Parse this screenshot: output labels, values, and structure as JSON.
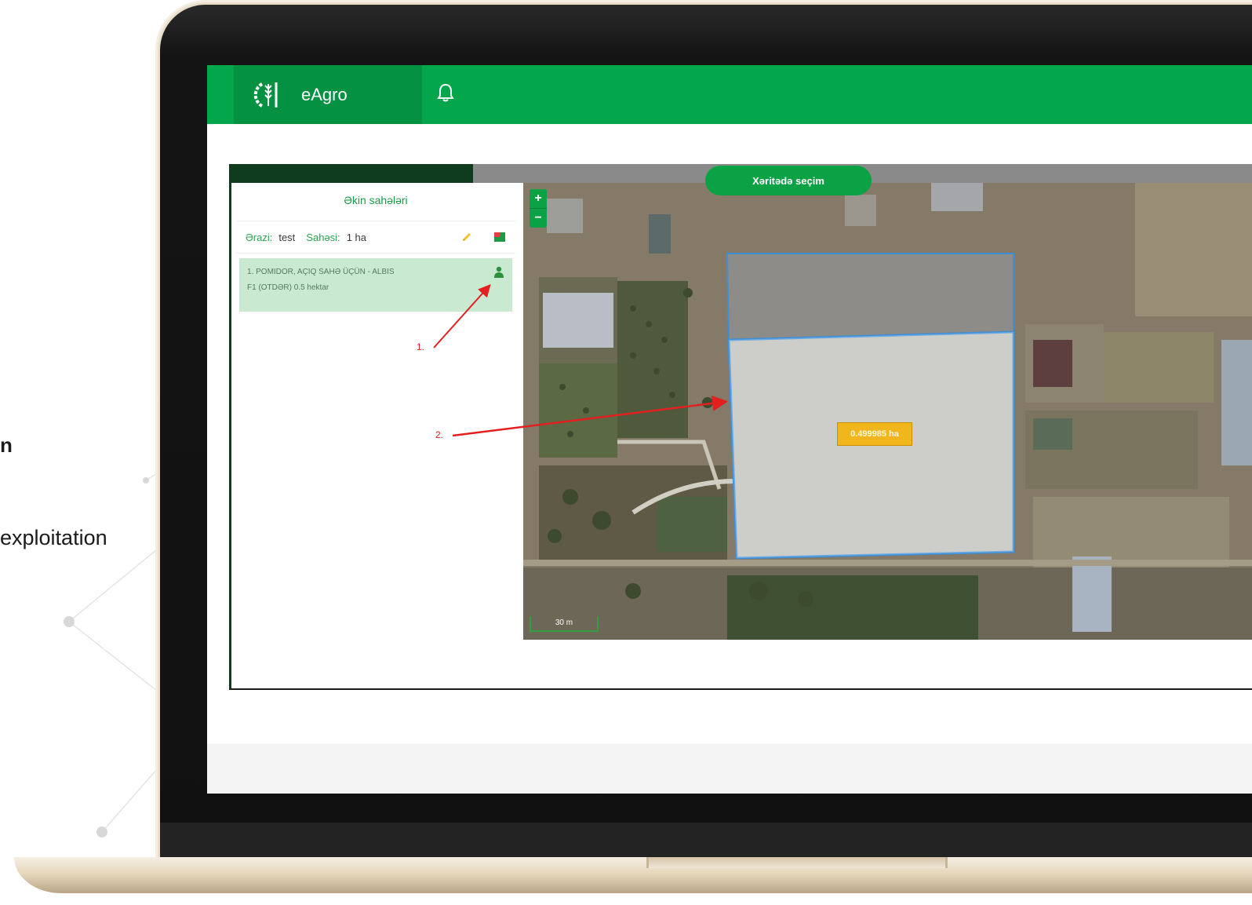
{
  "left_captions": {
    "line1": "n",
    "line2": "exploitation"
  },
  "app": {
    "name": "eAgro",
    "logo_icon": "wheat-gear-logo-icon",
    "notification_icon": "bell-icon",
    "colors": {
      "brand": "#04a64b",
      "brand_dark": "#049142",
      "accent_tag": "#f1b61b",
      "annotation": "#e32020"
    }
  },
  "panel": {
    "title": "Əkin sahələri",
    "field": {
      "label_area": "Ərazi:",
      "value_area": "test",
      "label_size": "Sahəsi:",
      "value_size": "1 ha"
    },
    "crop": {
      "line1": "1. POMIDOR, AÇIQ SAHƏ ÜÇÜN - ALBIS",
      "line2": "F1 (OTDƏR) 0.5 hektar"
    }
  },
  "map": {
    "select_button": "Xəritədə seçim",
    "zoom_in": "+",
    "zoom_out": "−",
    "area_tag": "0.499985 ha",
    "scale": "30 m"
  },
  "annotations": {
    "a1": "1.",
    "a2": "2."
  }
}
